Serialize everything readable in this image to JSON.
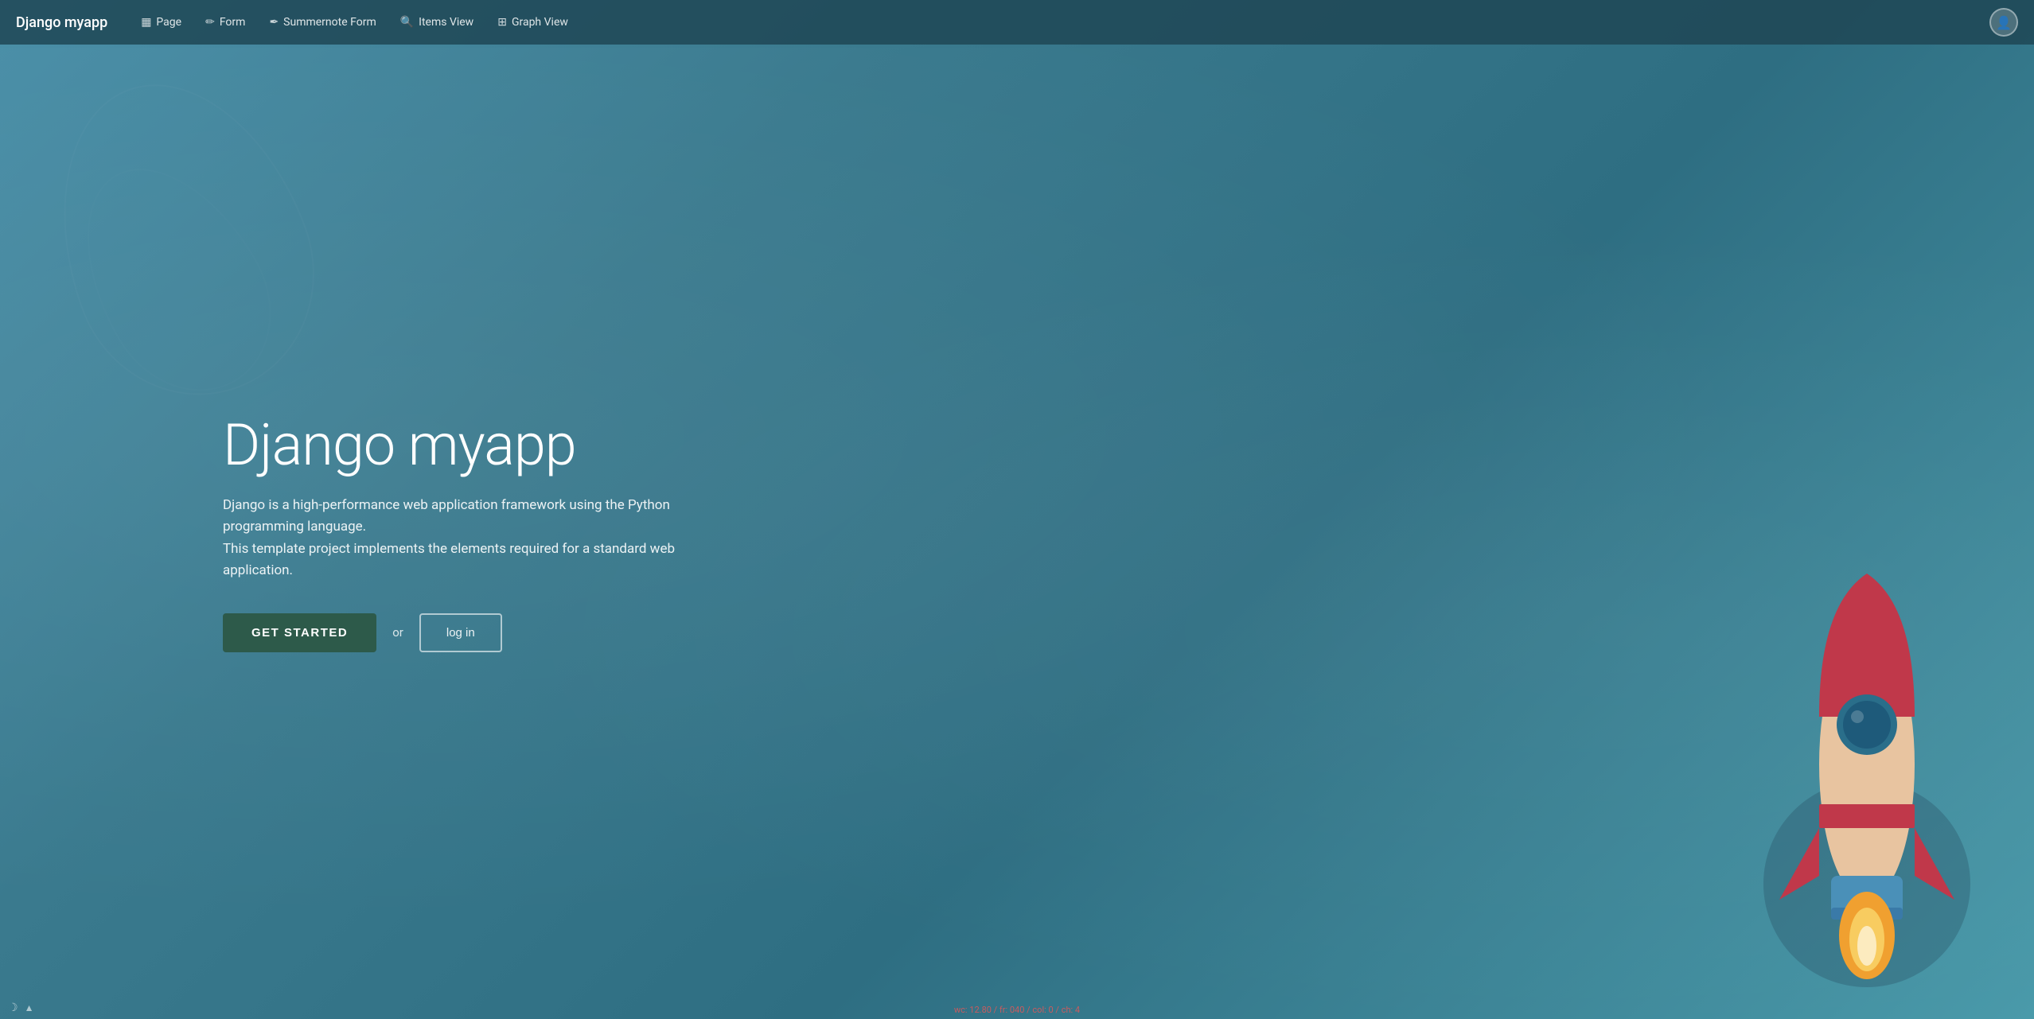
{
  "app": {
    "brand": "Django myapp",
    "avatar_icon": "👤"
  },
  "nav": {
    "links": [
      {
        "id": "page",
        "icon": "🗋",
        "label": "Page"
      },
      {
        "id": "form",
        "icon": "✏️",
        "label": "Form"
      },
      {
        "id": "summernote-form",
        "icon": "✒",
        "label": "Summernote Form"
      },
      {
        "id": "items-view",
        "icon": "🔍",
        "label": "Items View"
      },
      {
        "id": "graph-view",
        "icon": "⊞",
        "label": "Graph View"
      }
    ]
  },
  "hero": {
    "title": "Django myapp",
    "description_line1": "Django is a high-performance web application framework using the Python programming language.",
    "description_line2": "This template project implements the elements required for a standard web application.",
    "get_started_label": "GET STARTED",
    "or_label": "or",
    "login_label": "log in"
  },
  "status_bar": {
    "text": "wc: 12.80  /  fr: 040  /  col: 0  /  ch: 4"
  },
  "bottom": {
    "moon_icon": "☽",
    "arrow_icon": "▲"
  }
}
